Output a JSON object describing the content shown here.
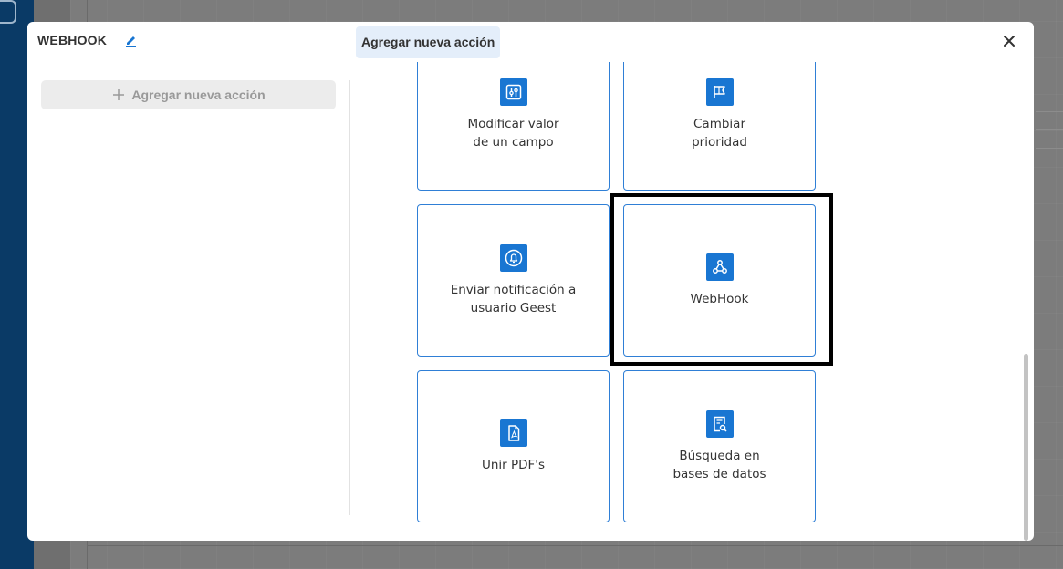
{
  "modal": {
    "title": "WEBHOOK",
    "tab_label": "Agregar nueva acción",
    "add_action_label": "Agregar nueva acción"
  },
  "actions": [
    {
      "label": "Modificar valor\nde un campo",
      "icon": "sliders-icon"
    },
    {
      "label": "Cambiar\nprioridad",
      "icon": "flag-icon"
    },
    {
      "label": "Enviar notificación a\nusuario Geest",
      "icon": "bell-icon"
    },
    {
      "label": "WebHook",
      "icon": "webhook-icon"
    },
    {
      "label": "Unir PDF's",
      "icon": "pdf-icon"
    },
    {
      "label": "Búsqueda en\nbases de datos",
      "icon": "database-search-icon"
    }
  ],
  "colors": {
    "accent": "#1976d2",
    "card_border": "#2f7fd6",
    "tab_bg": "#e4eefa"
  }
}
